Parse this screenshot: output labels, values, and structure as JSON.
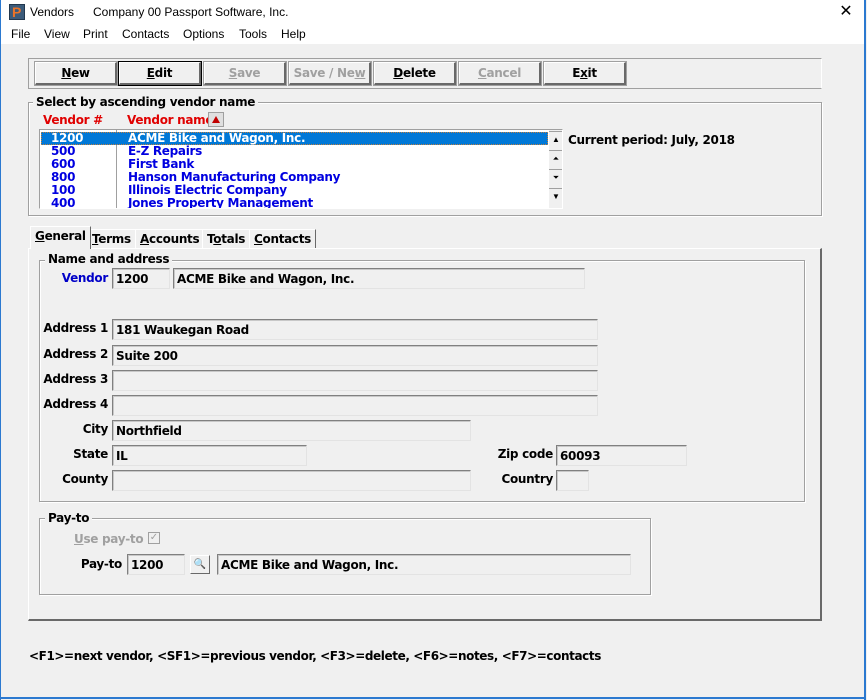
{
  "window": {
    "title": "Vendors",
    "company": "Company 00  Passport Software, Inc.",
    "app_icon_letter": "P",
    "close_glyph": "✕"
  },
  "menu": [
    "File",
    "View",
    "Print",
    "Contacts",
    "Options",
    "Tools",
    "Help"
  ],
  "toolbar": {
    "new": {
      "pre": "",
      "ul": "N",
      "post": "ew",
      "enabled": true
    },
    "edit": {
      "pre": "",
      "ul": "E",
      "post": "dit",
      "enabled": true
    },
    "save": {
      "pre": "",
      "ul": "S",
      "post": "ave",
      "enabled": false
    },
    "save_new": {
      "pre": "Save / Ne",
      "ul": "w",
      "post": "",
      "enabled": false
    },
    "delete": {
      "pre": "",
      "ul": "D",
      "post": "elete",
      "enabled": true
    },
    "cancel": {
      "pre": "",
      "ul": "C",
      "post": "ancel",
      "enabled": false
    },
    "exit": {
      "pre": "E",
      "ul": "x",
      "post": "it",
      "enabled": true
    }
  },
  "selector": {
    "group_label": "Select by ascending vendor name",
    "col_vendor_num": "Vendor #",
    "col_vendor_name": "Vendor name",
    "sort_icon": "sort-ascending-icon",
    "current_period": "Current period: July, 2018",
    "rows": [
      {
        "num": "1200",
        "name": "ACME Bike and Wagon, Inc.",
        "selected": true
      },
      {
        "num": "500",
        "name": "E-Z Repairs",
        "selected": false
      },
      {
        "num": "600",
        "name": "First Bank",
        "selected": false
      },
      {
        "num": "800",
        "name": "Hanson Manufacturing Company",
        "selected": false
      },
      {
        "num": "100",
        "name": "Illinois Electric Company",
        "selected": false
      },
      {
        "num": "400",
        "name": "Jones Property Management",
        "selected": false
      }
    ]
  },
  "tabs": [
    {
      "ul": "G",
      "post": "eneral",
      "active": true
    },
    {
      "ul": "T",
      "post": "erms",
      "active": false
    },
    {
      "ul": "A",
      "post": "ccounts",
      "active": false
    },
    {
      "pre": "T",
      "ul": "o",
      "post": "tals",
      "active": false
    },
    {
      "ul": "C",
      "post": "ontacts",
      "active": false
    }
  ],
  "general": {
    "name_address_label": "Name and address",
    "vendor_label": "Vendor",
    "vendor_num": "1200",
    "vendor_name": "ACME Bike and Wagon, Inc.",
    "address1_label": "Address 1",
    "address1": "181 Waukegan Road",
    "address2_label": "Address 2",
    "address2": "Suite 200",
    "address3_label": "Address 3",
    "address3": "",
    "address4_label": "Address 4",
    "address4": "",
    "city_label": "City",
    "city": "Northfield",
    "state_label": "State",
    "state": "IL",
    "zip_label": "Zip code",
    "zip": "60093",
    "county_label": "County",
    "county": "",
    "country_label": "Country",
    "country": ""
  },
  "payto": {
    "group_label": "Pay-to",
    "use_payto_ul": "U",
    "use_payto_post": "se pay-to",
    "use_payto_checked": true,
    "payto_label": "Pay-to",
    "payto_num": "1200",
    "payto_name": "ACME Bike and Wagon, Inc.",
    "lookup_icon": "binoculars-icon"
  },
  "status_line": "<F1>=next vendor, <SF1>=previous vendor, <F3>=delete, <F6>=notes, <F7>=contacts"
}
